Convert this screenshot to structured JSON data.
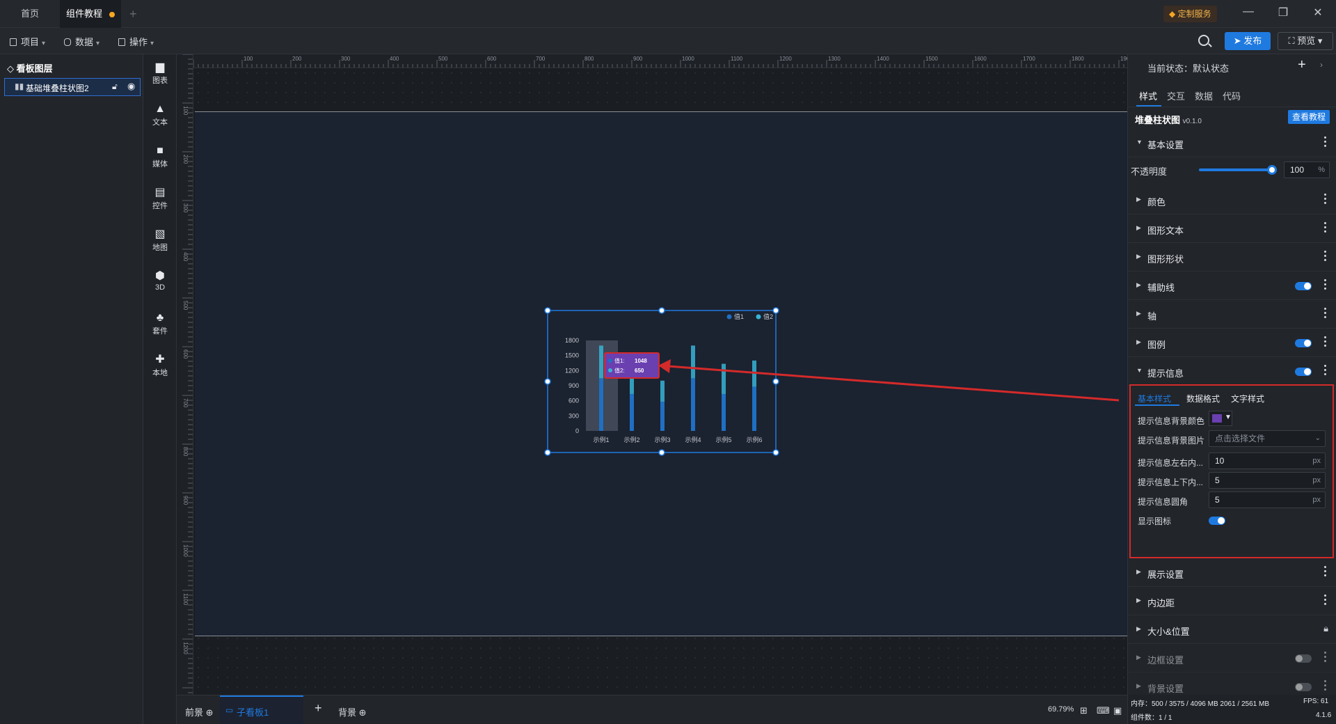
{
  "tabs": {
    "home": "首页",
    "active": "组件教程"
  },
  "service": "定制服务",
  "toolbar": {
    "project": "项目",
    "data": "数据",
    "operate": "操作",
    "publish": "发布",
    "preview": "预览"
  },
  "layers": {
    "title": "看板图层",
    "item": "基础堆叠柱状图2"
  },
  "components": [
    "图表",
    "文本",
    "媒体",
    "控件",
    "地图",
    "3D",
    "套件",
    "本地"
  ],
  "ruler_h": [
    "100",
    "200",
    "300",
    "400",
    "500",
    "600",
    "700",
    "800",
    "900",
    "1000",
    "1100",
    "1200",
    "1300",
    "1400",
    "1500",
    "1600",
    "1700",
    "1800",
    "1900"
  ],
  "ruler_v": [
    "100",
    "200",
    "300",
    "400",
    "500",
    "600",
    "700",
    "800",
    "900",
    "1000",
    "1100",
    "1200"
  ],
  "chart_data": {
    "type": "bar",
    "stacked": true,
    "categories": [
      "示例1",
      "示例2",
      "示例3",
      "示例4",
      "示例5",
      "示例6"
    ],
    "series": [
      {
        "name": "值1",
        "values": [
          1048,
          735,
          580,
          1048,
          735,
          880
        ]
      },
      {
        "name": "值2",
        "values": [
          650,
          480,
          420,
          650,
          600,
          520
        ]
      }
    ],
    "yticks": [
      "0",
      "300",
      "600",
      "900",
      "1200",
      "1500",
      "1800"
    ],
    "ylim": [
      0,
      1800
    ],
    "legend_position": "top-right",
    "tooltip": {
      "rows": [
        {
          "label": "值1:",
          "value": "1048"
        },
        {
          "label": "值2:",
          "value": "650"
        }
      ]
    },
    "colors": {
      "bottom": "#1f6fc2",
      "top": "#36b4d6"
    }
  },
  "bottombar": {
    "front": "前景",
    "sub": "子看板1",
    "bg": "背景",
    "zoom": "69.79%"
  },
  "right_panel": {
    "state_label": "当前状态：默认状态",
    "tabs": [
      "样式",
      "交互",
      "数据",
      "代码"
    ],
    "component_name": "堆叠柱状图",
    "version": "v0.1.0",
    "tutorial_btn": "查看教程",
    "basic": "基本设置",
    "opacity_label": "不透明度",
    "opacity_value": "100",
    "opacity_unit": "%",
    "opacity_level": 1.0,
    "sections": [
      "颜色",
      "图形文本",
      "图形形状",
      "辅助线",
      "轴",
      "图例",
      "提示信息"
    ],
    "tooltip_tabs": [
      "基本样式",
      "数据格式",
      "文字样式"
    ],
    "tooltip_fields": {
      "bg_color_label": "提示信息背景颜色",
      "bg_image_label": "提示信息背景图片",
      "bg_image_placeholder": "点击选择文件",
      "pad_lr_label": "提示信息左右内...",
      "pad_lr_value": "10",
      "pad_tb_label": "提示信息上下内...",
      "pad_tb_value": "5",
      "radius_label": "提示信息圆角",
      "radius_value": "5",
      "unit": "px",
      "show_icon_label": "显示图标"
    },
    "tooltip_bg_color": "#6a3fb0",
    "lower_sections": [
      "展示设置",
      "内边距",
      "大小&位置",
      "边框设置",
      "背景设置"
    ]
  },
  "status": {
    "memory": "内存：500 / 3575 / 4096 MB  2061 / 2561 MB",
    "fps": "FPS: 61",
    "count": "组件数：1 / 1",
    "version": "4.1.6"
  }
}
